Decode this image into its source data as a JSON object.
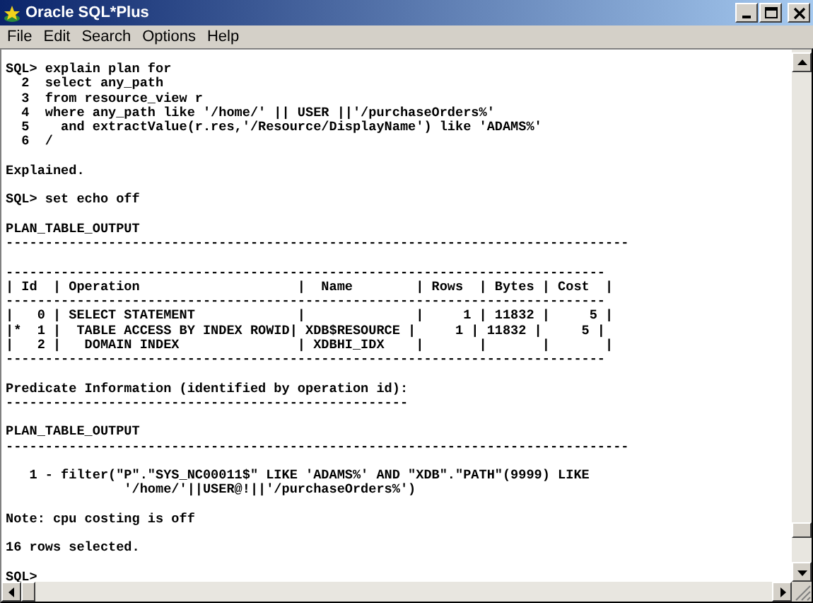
{
  "window": {
    "title": "Oracle SQL*Plus"
  },
  "menu": [
    "File",
    "Edit",
    "Search",
    "Options",
    "Help"
  ],
  "console_blocks": [
    [
      "SQL> explain plan for",
      "  2  select any_path",
      "  3  from resource_view r",
      "  4  where any_path like '/home/' || USER ||'/purchaseOrders%'",
      "  5    and extractValue(r.res,'/Resource/DisplayName') like 'ADAMS%'",
      "  6  /"
    ],
    [
      "Explained."
    ],
    [
      "SQL> set echo off"
    ],
    [
      "PLAN_TABLE_OUTPUT",
      "-------------------------------------------------------------------------------"
    ],
    [
      "----------------------------------------------------------------------------",
      "| Id  | Operation                    |  Name        | Rows  | Bytes | Cost  |",
      "----------------------------------------------------------------------------",
      "|   0 | SELECT STATEMENT             |              |     1 | 11832 |     5 |",
      "|*  1 |  TABLE ACCESS BY INDEX ROWID| XDB$RESOURCE |     1 | 11832 |     5 |",
      "|   2 |   DOMAIN INDEX               | XDBHI_IDX    |       |       |       |",
      "----------------------------------------------------------------------------"
    ],
    [
      "Predicate Information (identified by operation id):",
      "---------------------------------------------------"
    ],
    [
      "PLAN_TABLE_OUTPUT",
      "-------------------------------------------------------------------------------"
    ],
    [
      "   1 - filter(\"P\".\"SYS_NC00011$\" LIKE 'ADAMS%' AND \"XDB\".\"PATH\"(9999) LIKE",
      "               '/home/'||USER@!||'/purchaseOrders%')"
    ],
    [
      "Note: cpu costing is off"
    ],
    [
      "16 rows selected."
    ],
    [
      "SQL>"
    ]
  ]
}
